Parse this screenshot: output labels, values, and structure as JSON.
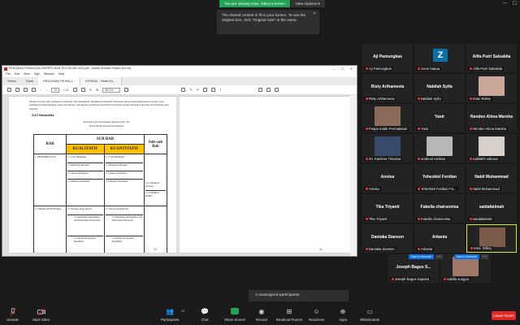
{
  "banner": {
    "viewing": "You are viewing miss. Dilkoy's screen",
    "view_options": "View Options"
  },
  "tooltip": {
    "text": "The shared content is fit to your screen. To see the original size, click \"Original Size\" in the menu."
  },
  "acrobat": {
    "title": "PEDOMAN PENULISAN SKRIPSI DAN TA.K.EKOM 2022.pdf - Adobe Acrobat Reader (64-bit)",
    "menu": [
      "File",
      "Edit",
      "View",
      "Sign",
      "Window",
      "Help"
    ],
    "tabs": [
      "Home",
      "Tools",
      "PEDOMAN PENULI...",
      "KPSI511 - Riset Ku..."
    ],
    "page_current": "19",
    "page_total": "/ 21",
    "zoom": "80,3%",
    "body_text": "Skripsi berdari dari penelitian kualitatif dan kuantitatif. Penelitian kualitatif bertujuan untuk menginterpretasi sesuatu atau pemaknaan mengungkap suatu fenomena, sedangkan penelitian kuantitatif bertujuan untuk menguji hipotesis berdasarkan data empiris.",
    "section_heading": "4.4.2  Sistematika",
    "caption_line1": "Struktur dan Sistematika Skripsi/Tesis TA",
    "caption_line2": "Prodi Ilkom Universitas Bakrie",
    "table": {
      "header_bab": "BAB",
      "header_sub_bab": "SUB BAB",
      "header_kualitatif": "KUALITATIF",
      "header_kuantitatif": "KUANTITATIF",
      "header_subsub": "Sub-sub Bab",
      "row1_bab": "1. PENDAHULUAN",
      "row1_kual": [
        "1.1 Latar Belakang",
        "1.2 Rumusan Masalah",
        "1.3 Tujuan Penelitian",
        "1.4 Manfaat Penelitian"
      ],
      "row1_kuan": [
        "1.1 Latar Belakang",
        "1.2 Rumusan Masalah",
        "1.3 Tujuan Penelitian",
        "1.4 Manfaat Penelitian"
      ],
      "row1_sub": [
        "1.4.1  Manfaat Teoretis",
        "1.4.2  Manfaat Praktis"
      ],
      "row2_bab": "2. TINJAUAN PUSTAKA",
      "row2_kual": [
        "2.1 Konsep yang relevan",
        "2.2 Penelitian Sebelumnya dan Pemosisian Keberesan",
        "2.3 Model Konseptual Penelitian"
      ],
      "row2_kuan": [
        "2.1 Teori yang Relevan",
        "2.2 Penelitian Sebelumnya dan Pemosisian Hipotesis",
        "2.3 Model Konseptual Penelitian"
      ]
    },
    "left_page_num": "23",
    "right_page_num": "24"
  },
  "participants": [
    {
      "name": "Aji Pamungkas",
      "label": "Aji Pamungkas",
      "kind": "text"
    },
    {
      "name": "",
      "label": "zoom baaaa",
      "kind": "avatar",
      "letter": "Z"
    },
    {
      "name": "Alifa Putri Salsabila",
      "label": "Alifa Putri Salsabila",
      "kind": "text"
    },
    {
      "name": "Risty Arthamevia",
      "label": "Risty Arthamevia",
      "kind": "text"
    },
    {
      "name": "Nabilah Syifa",
      "label": "Nabilah Syifa",
      "kind": "text"
    },
    {
      "name": "",
      "label": "Intan Rizkie",
      "kind": "photo",
      "color": "#caa79a"
    },
    {
      "name": "",
      "label": "Puspa Indah Permatasari",
      "kind": "photo",
      "color": "#8a6b5a"
    },
    {
      "name": "Yasir",
      "label": "Yasir",
      "kind": "text"
    },
    {
      "name": "Nenden Alima Marsha",
      "label": "Nenden Alima Marsha",
      "kind": "text"
    },
    {
      "name": "",
      "label": "20. Karisma Trisasna",
      "kind": "photo",
      "color": "#3a4a6a"
    },
    {
      "name": "",
      "label": "andriuul melissa",
      "kind": "photo",
      "color": "#b8b8b8"
    },
    {
      "name": "",
      "label": "nabilahh wibowo",
      "kind": "photo",
      "color": "#d7d0c8"
    },
    {
      "name": "Annisa",
      "label": "Annisa",
      "kind": "text"
    },
    {
      "name": "Yehezkiel Ferdian",
      "label": "Yehezkiel Ferdian Fra...",
      "kind": "text"
    },
    {
      "name": "Nabil Muhammad",
      "label": "Nabil Muhammad",
      "kind": "text"
    },
    {
      "name": "Tika Triyanti",
      "label": "Tika Triyanti",
      "kind": "text"
    },
    {
      "name": "Fabella chairunnisa",
      "label": "Fabella chairunnisa",
      "kind": "text"
    },
    {
      "name": "saidafatimah",
      "label": "saidafatimah",
      "kind": "text"
    },
    {
      "name": "Daniaka Sianson",
      "label": "Daniaka Sianson",
      "kind": "text"
    },
    {
      "name": "Arkania",
      "label": "Arkania",
      "kind": "text"
    },
    {
      "name": "",
      "label": "miss. Dilkoy",
      "kind": "photo",
      "color": "#7a5a48",
      "active": true
    },
    {
      "name": "Joseph Bagus S...",
      "label": "Joseph Bagus Saputra",
      "kind": "text"
    },
    {
      "name": "",
      "label": "nabilla surgyat",
      "kind": "photo",
      "color": "#a07868"
    }
  ],
  "ask_to_unmute": "Ask to Unmute",
  "unassigned": "3 unassigned participants",
  "toolbar": {
    "unmute": "Unmute",
    "start_video": "Start Video",
    "participants": "Participants",
    "participants_count": "23",
    "chat": "Chat",
    "share_screen": "Share Screen",
    "record": "Record",
    "breakout": "Breakout Rooms",
    "reactions": "Reactions",
    "apps": "Apps",
    "whiteboards": "Whiteboards",
    "leave": "Leave Room"
  },
  "colors": {
    "share_green": "#23a455",
    "leave_red": "#e02828",
    "ask_blue": "#0e72ed",
    "highlight_yellow": "#ffc000",
    "active_border": "#d6e81a"
  }
}
